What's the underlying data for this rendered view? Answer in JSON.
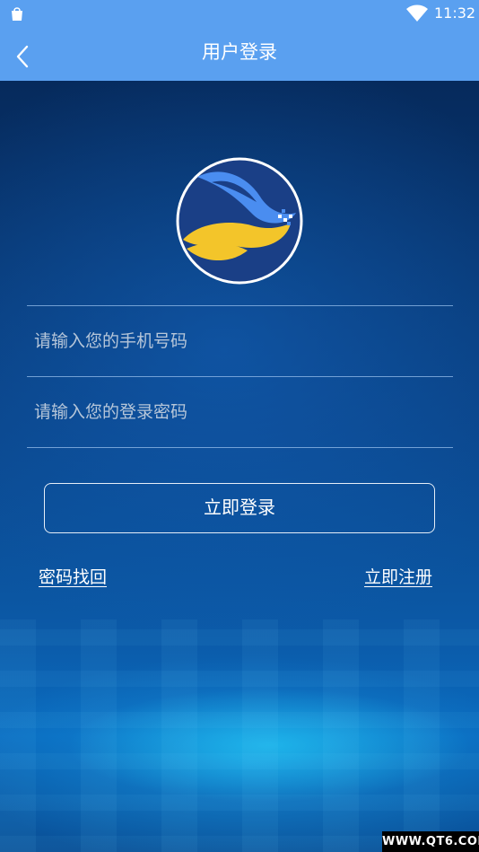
{
  "status_bar": {
    "time": "11:32",
    "left_icon": "bag-icon",
    "wifi_icon": "wifi-icon"
  },
  "app_bar": {
    "title": "用户登录",
    "back_icon": "chevron-left-icon",
    "background": "#5aa0f0"
  },
  "logo": {
    "icon": "app-logo",
    "colors": [
      "#1a3f86",
      "#4a8df0",
      "#f3c52a",
      "#ffffff"
    ]
  },
  "form": {
    "phone_placeholder": "请输入您的手机号码",
    "password_placeholder": "请输入您的登录密码",
    "login_label": "立即登录"
  },
  "links": {
    "forgot_password": "密码找回",
    "register": "立即注册"
  },
  "watermark": "WWW.QT6.COM"
}
